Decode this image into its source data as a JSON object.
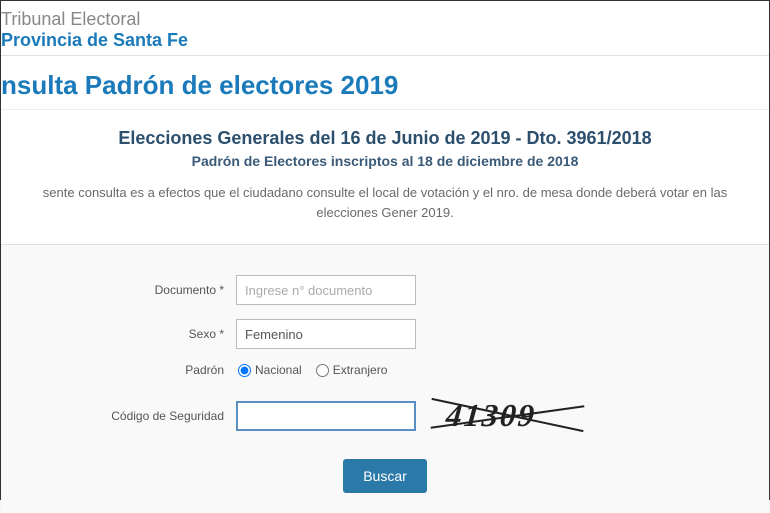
{
  "header": {
    "line1": "Tribunal Electoral",
    "line2": "Provincia de Santa Fe"
  },
  "page_title": "nsulta Padrón de electores 2019",
  "info": {
    "main": "Elecciones Generales del 16 de Junio de 2019 - Dto. 3961/2018",
    "sub": "Padrón de Electores inscriptos al 18 de diciembre de 2018",
    "desc": "sente consulta es a efectos que el ciudadano consulte el local de votación y el nro. de mesa donde deberá votar en las elecciones Gener 2019."
  },
  "form": {
    "documento": {
      "label": "Documento *",
      "placeholder": "Ingrese n° documento",
      "value": ""
    },
    "sexo": {
      "label": "Sexo *",
      "value": "Femenino"
    },
    "padron": {
      "label": "Padrón",
      "options": {
        "nacional": "Nacional",
        "extranjero": "Extranjero"
      },
      "selected": "nacional"
    },
    "codigo": {
      "label": "Código de Seguridad",
      "value": ""
    },
    "captcha": "41309",
    "button": "Buscar"
  }
}
